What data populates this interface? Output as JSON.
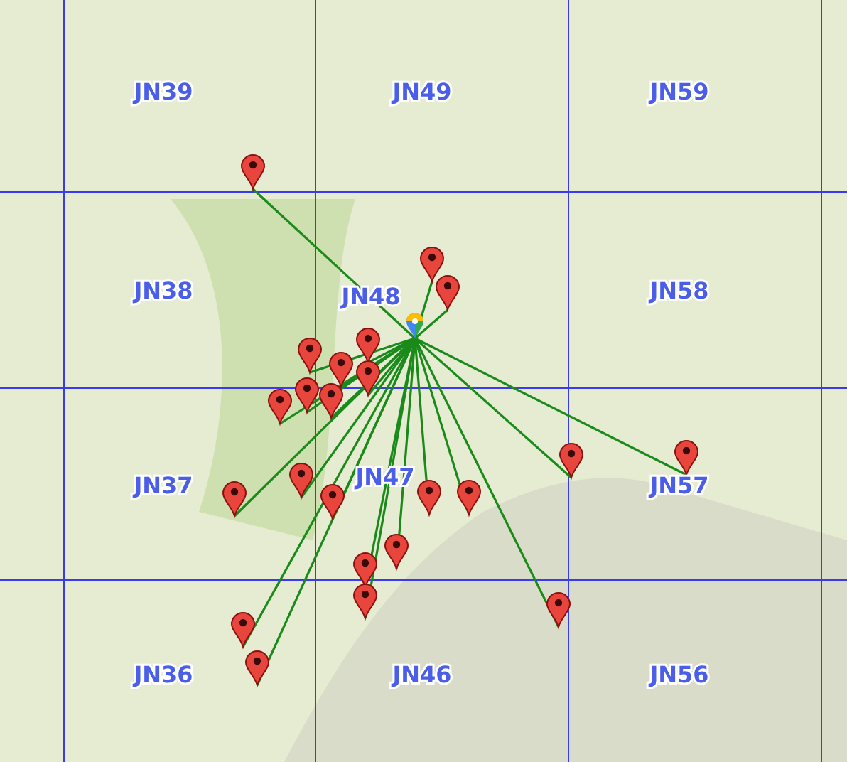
{
  "grid_squares": [
    {
      "label": "JN39"
    },
    {
      "label": "JN49"
    },
    {
      "label": "JN59"
    },
    {
      "label": "JN38"
    },
    {
      "label": "JN48"
    },
    {
      "label": "JN58"
    },
    {
      "label": "JN37"
    },
    {
      "label": "JN47"
    },
    {
      "label": "JN57"
    },
    {
      "label": "JN36"
    },
    {
      "label": "JN46"
    },
    {
      "label": "JN56"
    }
  ]
}
